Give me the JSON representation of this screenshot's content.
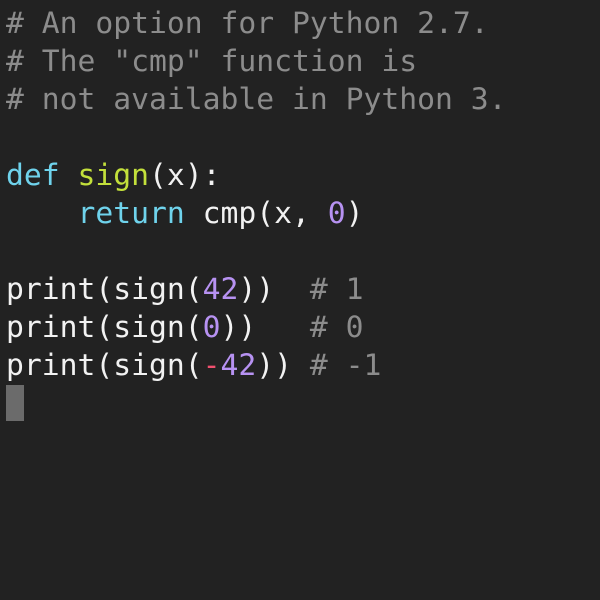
{
  "editor": {
    "language": "python",
    "lines": [
      [
        {
          "t": "comment",
          "text": "# An option for Python 2.7."
        }
      ],
      [
        {
          "t": "comment",
          "text": "# The \"cmp\" function is"
        }
      ],
      [
        {
          "t": "comment",
          "text": "# not available in Python 3."
        }
      ],
      [],
      [
        {
          "t": "keyword",
          "text": "def"
        },
        {
          "t": "plain",
          "text": " "
        },
        {
          "t": "funcname",
          "text": "sign"
        },
        {
          "t": "plain",
          "text": "(x):"
        }
      ],
      [
        {
          "t": "plain",
          "text": "    "
        },
        {
          "t": "keyword",
          "text": "return"
        },
        {
          "t": "plain",
          "text": " cmp(x, "
        },
        {
          "t": "number",
          "text": "0"
        },
        {
          "t": "plain",
          "text": ")"
        }
      ],
      [],
      [
        {
          "t": "plain",
          "text": "print(sign("
        },
        {
          "t": "number",
          "text": "42"
        },
        {
          "t": "plain",
          "text": "))  "
        },
        {
          "t": "comment",
          "text": "# 1"
        }
      ],
      [
        {
          "t": "plain",
          "text": "print(sign("
        },
        {
          "t": "number",
          "text": "0"
        },
        {
          "t": "plain",
          "text": "))   "
        },
        {
          "t": "comment",
          "text": "# 0"
        }
      ],
      [
        {
          "t": "plain",
          "text": "print(sign("
        },
        {
          "t": "operator",
          "text": "-"
        },
        {
          "t": "number",
          "text": "42"
        },
        {
          "t": "plain",
          "text": ")) "
        },
        {
          "t": "comment",
          "text": "# -1"
        }
      ]
    ],
    "cursor_line": 11
  },
  "colors": {
    "background": "#222222",
    "comment": "#8c8c8c",
    "keyword": "#6fd3ec",
    "function_name": "#c3e03b",
    "number": "#b792f2",
    "operator": "#f0506e",
    "text": "#f2f2f2",
    "cursor": "#6b6b6b"
  }
}
